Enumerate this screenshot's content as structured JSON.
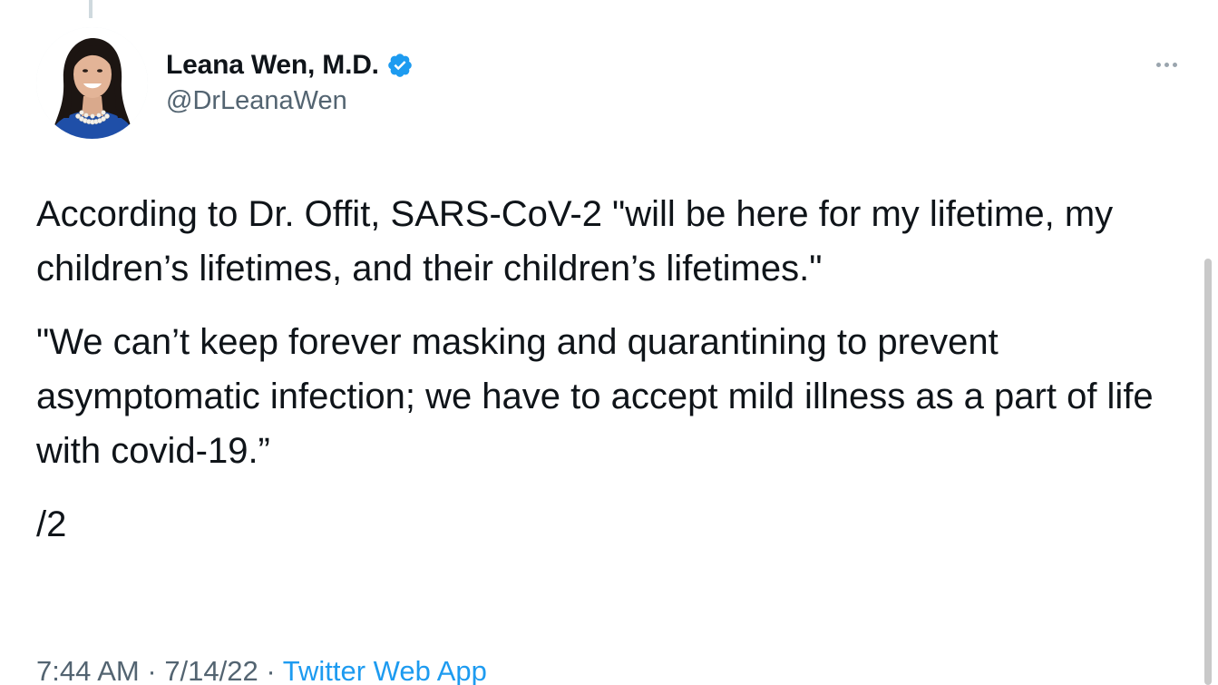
{
  "tweet": {
    "author": {
      "display_name": "Leana Wen, M.D.",
      "handle": "@DrLeanaWen",
      "verified": true,
      "verified_color": "#1d9bf0"
    },
    "paragraphs": [
      "According to Dr. Offit, SARS-CoV-2 \"will be here for my lifetime, my children’s lifetimes, and their children’s lifetimes.\"",
      "\"We can’t keep forever masking and quarantining to prevent asymptomatic infection; we have to accept mild illness as a part of life with covid-19.”",
      "/2"
    ],
    "meta": {
      "time": "7:44 AM",
      "separator": " · ",
      "date": "7/14/22",
      "source": "Twitter Web App"
    }
  },
  "icons": {
    "more": "more-options-icon",
    "verified": "verified-badge-icon"
  },
  "colors": {
    "text_primary": "#0f1419",
    "text_secondary": "#536471",
    "link": "#1d9bf0"
  }
}
